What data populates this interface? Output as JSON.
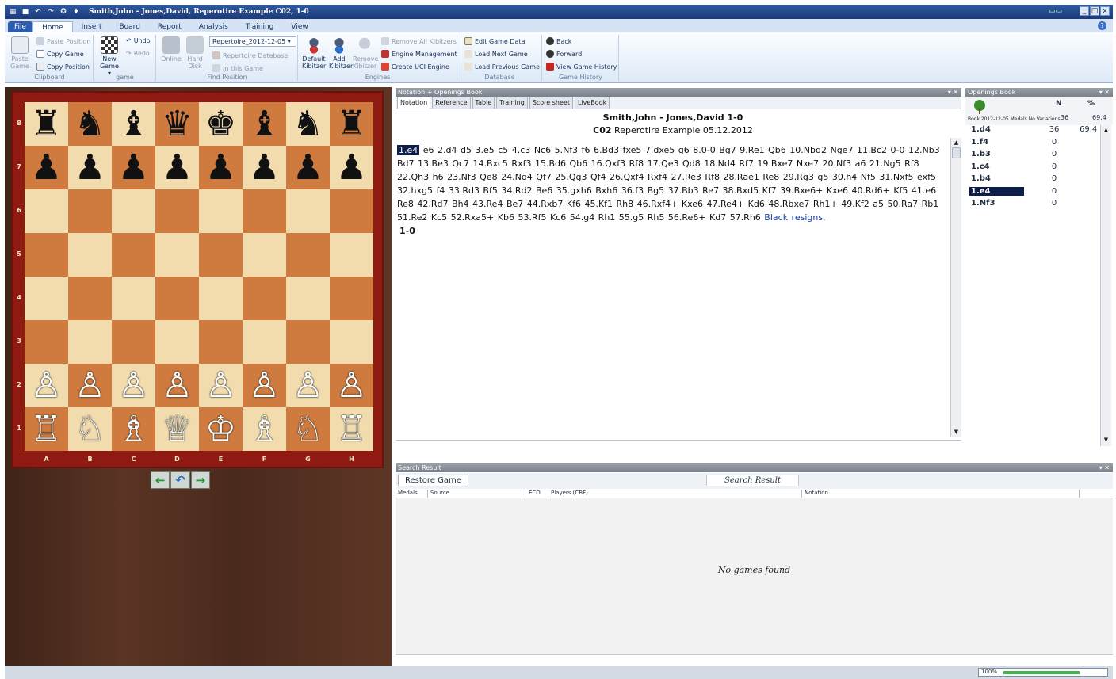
{
  "window": {
    "title": "Smith,John - Jones,David, Reperotire Example  C02, 1-0",
    "controls": [
      "_",
      "□",
      "x"
    ]
  },
  "ribbon": {
    "file_label": "File",
    "tabs": [
      "Home",
      "Insert",
      "Board",
      "Report",
      "Analysis",
      "Training",
      "View"
    ],
    "active_tab": "Home",
    "clipboard": {
      "name": "Clipboard",
      "paste_game": "Paste\nGame",
      "paste_position": "Paste Position",
      "copy_game": "Copy Game",
      "copy_position": "Copy Position"
    },
    "game": {
      "name": "game",
      "new_game": "New\nGame ▾",
      "undo": "Undo",
      "redo": "Redo"
    },
    "find_position": {
      "name": "Find Position",
      "online": "Online",
      "hard_disk": "Hard\nDisk",
      "repertoire_combo": "Repertoire_2012-12-05",
      "repertoire_db": "Repertoire Database",
      "in_this_game": "In this Game"
    },
    "engines": {
      "name": "Engines",
      "default_kibitzer": "Default\nKibitzer",
      "add_kibitzer": "Add\nKibitzer",
      "remove_kibitzer": "Remove\nKibitzer",
      "remove_all": "Remove All Kibitzers",
      "engine_management": "Engine Management",
      "create_uci": "Create UCI Engine"
    },
    "database": {
      "name": "Database",
      "edit_game_data": "Edit Game Data",
      "load_next": "Load Next Game",
      "load_previous": "Load Previous Game"
    },
    "game_history": {
      "name": "Game History",
      "back": "Back",
      "forward": "Forward",
      "view_history": "View Game History"
    }
  },
  "board": {
    "ranks": [
      "8",
      "7",
      "6",
      "5",
      "4",
      "3",
      "2",
      "1"
    ],
    "files": [
      "A",
      "B",
      "C",
      "D",
      "E",
      "F",
      "G",
      "H"
    ],
    "position": [
      [
        "♜",
        "♞",
        "♝",
        "♛",
        "♚",
        "♝",
        "♞",
        "♜"
      ],
      [
        "♟",
        "♟",
        "♟",
        "♟",
        "♟",
        "♟",
        "♟",
        "♟"
      ],
      [
        "",
        "",
        "",
        "",
        "",
        "",
        "",
        ""
      ],
      [
        "",
        "",
        "",
        "",
        "",
        "",
        "",
        ""
      ],
      [
        "",
        "",
        "",
        "",
        "",
        "",
        "",
        ""
      ],
      [
        "",
        "",
        "",
        "",
        "",
        "",
        "",
        ""
      ],
      [
        "♙",
        "♙",
        "♙",
        "♙",
        "♙",
        "♙",
        "♙",
        "♙"
      ],
      [
        "♖",
        "♘",
        "♗",
        "♕",
        "♔",
        "♗",
        "♘",
        "♖"
      ]
    ],
    "nav": [
      "←",
      "↶",
      "→"
    ]
  },
  "notation_panel": {
    "header": "Notation + Openings Book",
    "tabs": [
      "Notation",
      "Reference",
      "Table",
      "Training",
      "Score sheet",
      "LiveBook"
    ],
    "players": "Smith,John - Jones,David  1-0",
    "eco": "C02",
    "event": "Reperotire Example 05.12.2012",
    "current_move": "1.e4",
    "moves": "e6 2.d4 d5 3.e5 c5 4.c3 Nc6 5.Nf3 f6 6.Bd3 fxe5 7.dxe5 g6 8.0-0 Bg7 9.Re1 Qb6 10.Nbd2 Nge7 11.Bc2 0-0 12.Nb3 Bd7 13.Be3 Qc7 14.Bxc5 Rxf3 15.Bd6 Qb6 16.Qxf3 Rf8 17.Qe3 Qd8 18.Nd4 Rf7 19.Bxe7 Nxe7 20.Nf3 a6 21.Ng5 Rf8 22.Qh3 h6 23.Nf3 Qe8 24.Nd4 Qf7 25.Qg3 Qf4 26.Qxf4 Rxf4 27.Re3 Rf8 28.Rae1 Re8 29.Rg3 g5 30.h4 Nf5 31.Nxf5 exf5 32.hxg5 f4 33.Rd3 Bf5 34.Rd2 Be6 35.gxh6 Bxh6 36.f3 Bg5 37.Bb3 Re7 38.Bxd5 Kf7 39.Bxe6+ Kxe6 40.Rd6+ Kf5 41.e6 Re8 42.Rd7 Bh4 43.Re4 Be7 44.Rxb7 Kf6 45.Kf1 Rh8 46.Rxf4+ Kxe6 47.Re4+ Kd6 48.Rbxe7 Rh1+ 49.Kf2 a5 50.Ra7 Rb1 51.Re2 Kc5 52.Rxa5+ Kb6 53.Rf5 Kc6 54.g4 Rh1 55.g5 Rh5 56.Re6+ Kd7 57.Rh6",
    "comment": "Black resigns.",
    "result": "1-0"
  },
  "openings_book": {
    "header": "Openings Book",
    "col_n": "N",
    "col_pct": "%",
    "subheader": "Book  2012-12-05  Medals  No  Variations",
    "top_n": "36",
    "top_pct": "69.4",
    "rows": [
      {
        "move": "1.d4",
        "n": "36",
        "pct": "69.4"
      },
      {
        "move": "1.f4",
        "n": "0",
        "pct": ""
      },
      {
        "move": "1.b3",
        "n": "0",
        "pct": ""
      },
      {
        "move": "1.c4",
        "n": "0",
        "pct": ""
      },
      {
        "move": "1.b4",
        "n": "0",
        "pct": ""
      },
      {
        "move": "1.e4",
        "n": "0",
        "pct": ""
      },
      {
        "move": "1.Nf3",
        "n": "0",
        "pct": ""
      }
    ],
    "selected_index": 5
  },
  "search_result": {
    "header": "Search Result",
    "restore_button": "Restore Game",
    "label": "Search Result",
    "columns": [
      "Medals",
      "Source",
      "ECO",
      "Players (CBF)",
      "Notation"
    ],
    "empty_text": "No games found"
  },
  "status": {
    "zoom": "100%",
    "zoom_fraction": 0.75
  },
  "colors": {
    "accent": "#2b5cb0",
    "board_light": "#f2dcae",
    "board_dark": "#cf7a3e",
    "selection": "#0c1d4a"
  }
}
